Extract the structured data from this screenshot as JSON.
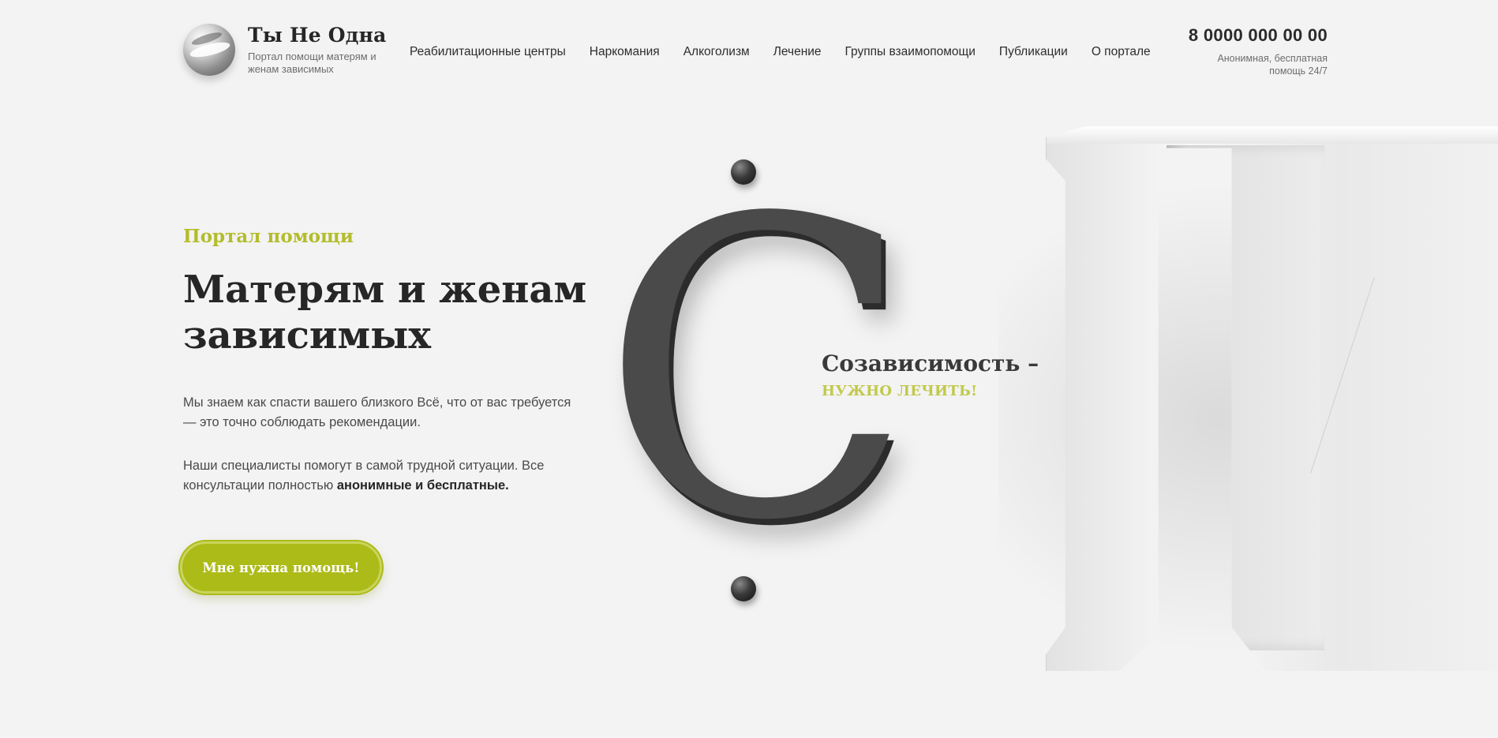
{
  "header": {
    "logo_title": "Ты Не Одна",
    "logo_subtitle": "Портал помощи матерям и женам зависимых",
    "nav": [
      {
        "label": "Реабилитационные центры"
      },
      {
        "label": "Наркомания"
      },
      {
        "label": "Алкоголизм"
      },
      {
        "label": "Лечение"
      },
      {
        "label": "Группы взаимопомощи"
      },
      {
        "label": "Публикации"
      },
      {
        "label": "О портале"
      }
    ],
    "phone": "8 0000 000 00 00",
    "phone_note": "Анонимная, бесплатная помощь 24/7"
  },
  "hero": {
    "eyebrow": "Портал помощи",
    "headline": "Матерям и женам зависимых",
    "paragraph_1": "Мы знаем как спасти вашего близкого Всё, что от вас требуется — это точно соблюдать рекомендации.",
    "paragraph_2_prefix": "Наши специалисты помогут в самой трудной ситуации. Все консультации полностью ",
    "paragraph_2_bold": "анонимные и бесплатные.",
    "cta_label": "Мне нужна помощь!"
  },
  "visual": {
    "letter_c": "С",
    "tagline_main": "Созависимость –",
    "tagline_accent": "НУЖНО ЛЕЧИТЬ!"
  },
  "colors": {
    "accent": "#acbb17",
    "accent_text": "#b3bd2c",
    "background": "#f3f3f3",
    "text": "#262626"
  }
}
